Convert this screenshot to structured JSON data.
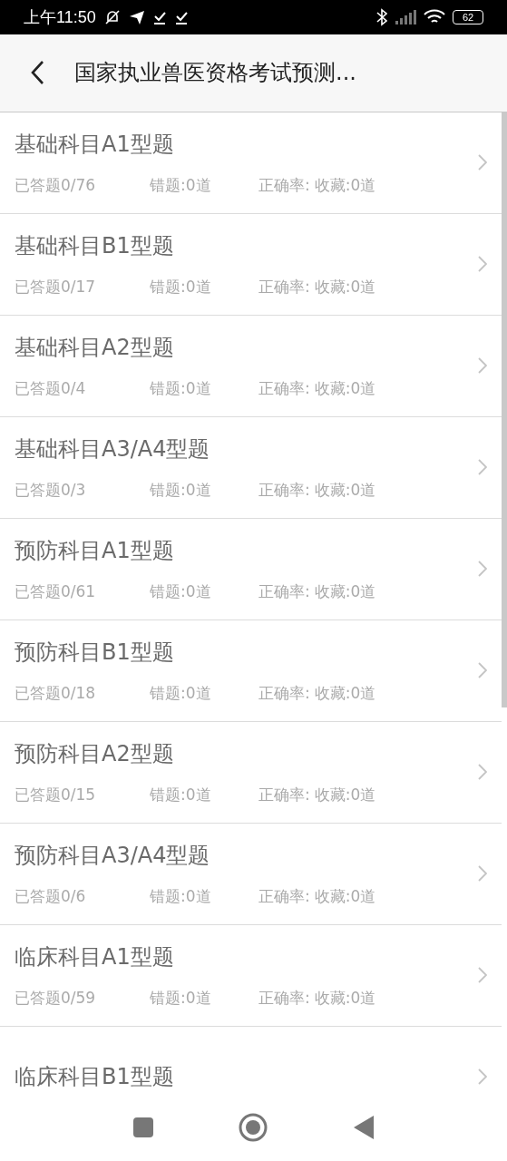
{
  "status_bar": {
    "time": "上午11:50",
    "battery": "62"
  },
  "header": {
    "title": "国家执业兽医资格考试预测..."
  },
  "items": [
    {
      "title": "基础科目A1型题",
      "answered": "已答题0/76",
      "wrong": "错题:0道",
      "accuracy": "正确率:",
      "favorites": "收藏:0道"
    },
    {
      "title": "基础科目B1型题",
      "answered": "已答题0/17",
      "wrong": "错题:0道",
      "accuracy": "正确率:",
      "favorites": "收藏:0道"
    },
    {
      "title": "基础科目A2型题",
      "answered": "已答题0/4",
      "wrong": "错题:0道",
      "accuracy": "正确率:",
      "favorites": "收藏:0道"
    },
    {
      "title": "基础科目A3/A4型题",
      "answered": "已答题0/3",
      "wrong": "错题:0道",
      "accuracy": "正确率:",
      "favorites": "收藏:0道"
    },
    {
      "title": "预防科目A1型题",
      "answered": "已答题0/61",
      "wrong": "错题:0道",
      "accuracy": "正确率:",
      "favorites": "收藏:0道"
    },
    {
      "title": "预防科目B1型题",
      "answered": "已答题0/18",
      "wrong": "错题:0道",
      "accuracy": "正确率:",
      "favorites": "收藏:0道"
    },
    {
      "title": "预防科目A2型题",
      "answered": "已答题0/15",
      "wrong": "错题:0道",
      "accuracy": "正确率:",
      "favorites": "收藏:0道"
    },
    {
      "title": "预防科目A3/A4型题",
      "answered": "已答题0/6",
      "wrong": "错题:0道",
      "accuracy": "正确率:",
      "favorites": "收藏:0道"
    },
    {
      "title": "临床科目A1型题",
      "answered": "已答题0/59",
      "wrong": "错题:0道",
      "accuracy": "正确率:",
      "favorites": "收藏:0道"
    },
    {
      "title": "临床科目B1型题"
    }
  ]
}
